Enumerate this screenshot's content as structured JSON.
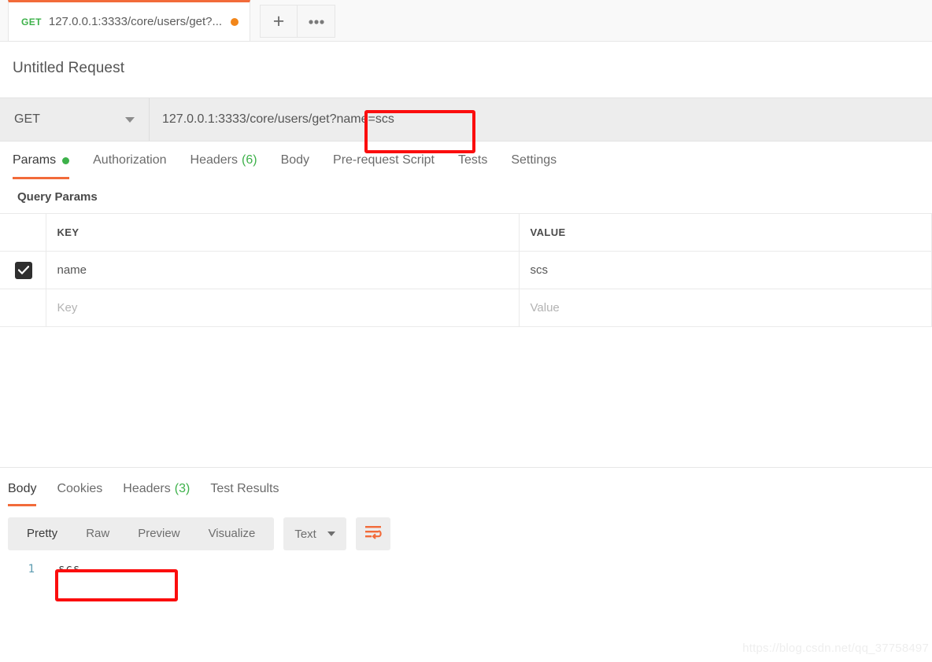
{
  "tabstrip": {
    "request_tab": {
      "method": "GET",
      "url_label": "127.0.0.1:3333/core/users/get?...",
      "unsaved_indicator": "unsaved-dot"
    },
    "new_tab_label": "+",
    "more_label": "●●●"
  },
  "request": {
    "title": "Untitled Request",
    "method": "GET",
    "url": "127.0.0.1:3333/core/users/get?name=scs",
    "url_prefix": "127.0.0.1:3333/core/users/get",
    "url_query": "?name=scs",
    "tabs": [
      {
        "label": "Params",
        "dot": true,
        "count": "",
        "active": true
      },
      {
        "label": "Authorization",
        "dot": false,
        "count": "",
        "active": false
      },
      {
        "label": "Headers",
        "dot": false,
        "count": "(6)",
        "active": false
      },
      {
        "label": "Body",
        "dot": false,
        "count": "",
        "active": false
      },
      {
        "label": "Pre-request Script",
        "dot": false,
        "count": "",
        "active": false
      },
      {
        "label": "Tests",
        "dot": false,
        "count": "",
        "active": false
      },
      {
        "label": "Settings",
        "dot": false,
        "count": "",
        "active": false
      }
    ],
    "params_section_label": "Query Params",
    "params_table": {
      "headers": [
        "KEY",
        "VALUE"
      ],
      "rows": [
        {
          "checked": true,
          "key": "name",
          "value": "scs"
        },
        {
          "checked": false,
          "key": "Key",
          "value": "Value",
          "is_placeholder": true
        }
      ]
    }
  },
  "response": {
    "tabs": [
      {
        "label": "Body",
        "count": "",
        "active": true
      },
      {
        "label": "Cookies",
        "count": "",
        "active": false
      },
      {
        "label": "Headers",
        "count": "(3)",
        "active": false
      },
      {
        "label": "Test Results",
        "count": "",
        "active": false
      }
    ],
    "view_modes": [
      {
        "label": "Pretty",
        "active": true
      },
      {
        "label": "Raw",
        "active": false
      },
      {
        "label": "Preview",
        "active": false
      },
      {
        "label": "Visualize",
        "active": false
      }
    ],
    "format": "Text",
    "wrap_icon": "word-wrap-icon",
    "body": {
      "line_number": "1",
      "content": "scs"
    }
  },
  "annotations": [
    {
      "name": "url-query-highlight",
      "color": "#fb0d0d"
    },
    {
      "name": "response-body-highlight",
      "color": "#fb0d0d"
    }
  ],
  "watermark": "https://blog.csdn.net/qq_37758497"
}
